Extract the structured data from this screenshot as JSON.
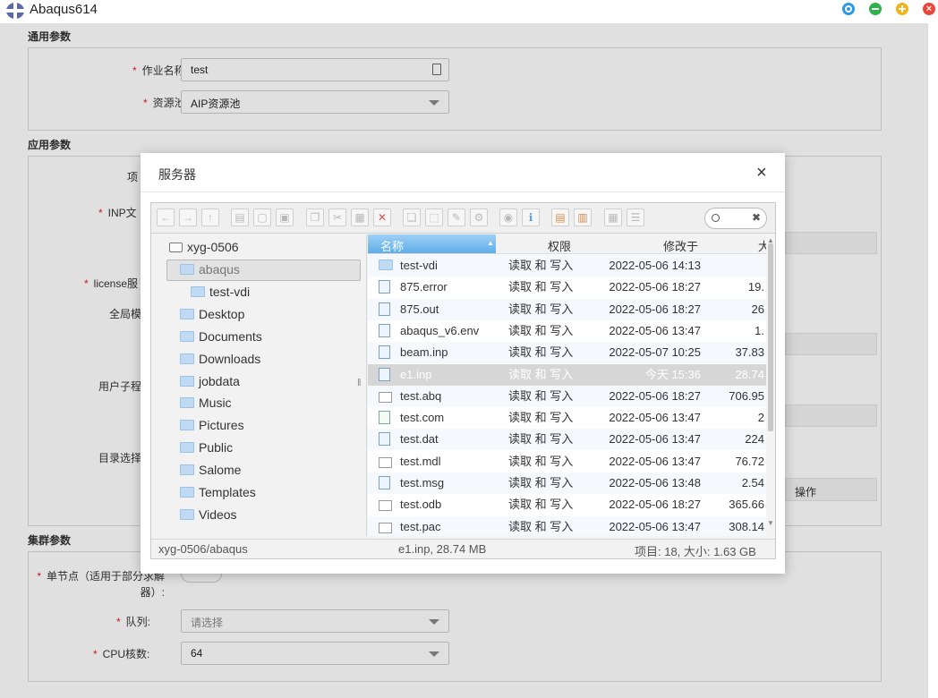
{
  "app": {
    "title": "Abaqus614"
  },
  "form": {
    "general_title": "通用参数",
    "app_title": "应用参数",
    "cluster_title": "集群参数",
    "job_name_label": "作业名称:",
    "job_name_value": "test",
    "pool_label": "资源池:",
    "pool_value": "AIP资源池",
    "project_label_partial": "项",
    "inp_label_partial": "INP文",
    "license_label_partial": "license服",
    "global_label_partial": "全局模",
    "user_sub_label_partial": "用户子程",
    "dir_select_label_partial": "目录选择",
    "ops_header": "操作",
    "single_node_label": "单节点（适用于部分求解器）:",
    "queue_label": "队列:",
    "queue_placeholder": "请选择",
    "cpu_label": "CPU核数:",
    "cpu_value": "64"
  },
  "dialog": {
    "title": "服务器",
    "close_glyph": "×",
    "tree": {
      "root": "xyg-0506",
      "items": [
        {
          "label": "abaqus",
          "level": 1,
          "selected": true
        },
        {
          "label": "test-vdi",
          "level": 2,
          "selected": false
        },
        {
          "label": "Desktop",
          "level": 1,
          "selected": false
        },
        {
          "label": "Documents",
          "level": 1,
          "selected": false
        },
        {
          "label": "Downloads",
          "level": 1,
          "selected": false
        },
        {
          "label": "jobdata",
          "level": 1,
          "selected": false
        },
        {
          "label": "Music",
          "level": 1,
          "selected": false
        },
        {
          "label": "Pictures",
          "level": 1,
          "selected": false
        },
        {
          "label": "Public",
          "level": 1,
          "selected": false
        },
        {
          "label": "Salome",
          "level": 1,
          "selected": false
        },
        {
          "label": "Templates",
          "level": 1,
          "selected": false
        },
        {
          "label": "Videos",
          "level": 1,
          "selected": false
        }
      ]
    },
    "columns": {
      "name": "名称",
      "perm": "权限",
      "modified": "修改于",
      "size": "大"
    },
    "files": [
      {
        "name": "test-vdi",
        "type": "folder",
        "perm": "读取 和 写入",
        "modified": "2022-05-06 14:13",
        "size": ""
      },
      {
        "name": "875.error",
        "type": "doc",
        "perm": "读取 和 写入",
        "modified": "2022-05-06 18:27",
        "size": "19."
      },
      {
        "name": "875.out",
        "type": "doc",
        "perm": "读取 和 写入",
        "modified": "2022-05-06 18:27",
        "size": "26"
      },
      {
        "name": "abaqus_v6.env",
        "type": "doc",
        "perm": "读取 和 写入",
        "modified": "2022-05-06 13:47",
        "size": "1."
      },
      {
        "name": "beam.inp",
        "type": "doc",
        "perm": "读取 和 写入",
        "modified": "2022-05-07 10:25",
        "size": "37.83"
      },
      {
        "name": "e1.inp",
        "type": "doc",
        "perm": "读取 和 写入",
        "modified": "今天 15:36",
        "size": "28.74",
        "selected": true
      },
      {
        "name": "test.abq",
        "type": "blank",
        "perm": "读取 和 写入",
        "modified": "2022-05-06 18:27",
        "size": "706.95"
      },
      {
        "name": "test.com",
        "type": "code",
        "perm": "读取 和 写入",
        "modified": "2022-05-06 13:47",
        "size": "2"
      },
      {
        "name": "test.dat",
        "type": "doc",
        "perm": "读取 和 写入",
        "modified": "2022-05-06 13:47",
        "size": "224"
      },
      {
        "name": "test.mdl",
        "type": "blank",
        "perm": "读取 和 写入",
        "modified": "2022-05-06 13:47",
        "size": "76.72"
      },
      {
        "name": "test.msg",
        "type": "doc",
        "perm": "读取 和 写入",
        "modified": "2022-05-06 13:48",
        "size": "2.54"
      },
      {
        "name": "test.odb",
        "type": "blank",
        "perm": "读取 和 写入",
        "modified": "2022-05-06 18:27",
        "size": "365.66"
      },
      {
        "name": "test.pac",
        "type": "blank",
        "perm": "读取 和 写入",
        "modified": "2022-05-06 13:47",
        "size": "308.14"
      }
    ],
    "status": {
      "path": "xyg-0506/abaqus",
      "selection": "e1.inp, 28.74 MB",
      "summary": "项目: 18, 大小: 1.63 GB"
    }
  },
  "colors": {
    "accent": "#5b9bd5",
    "required": "#e02020",
    "selected_row": "#d6d6d6"
  }
}
